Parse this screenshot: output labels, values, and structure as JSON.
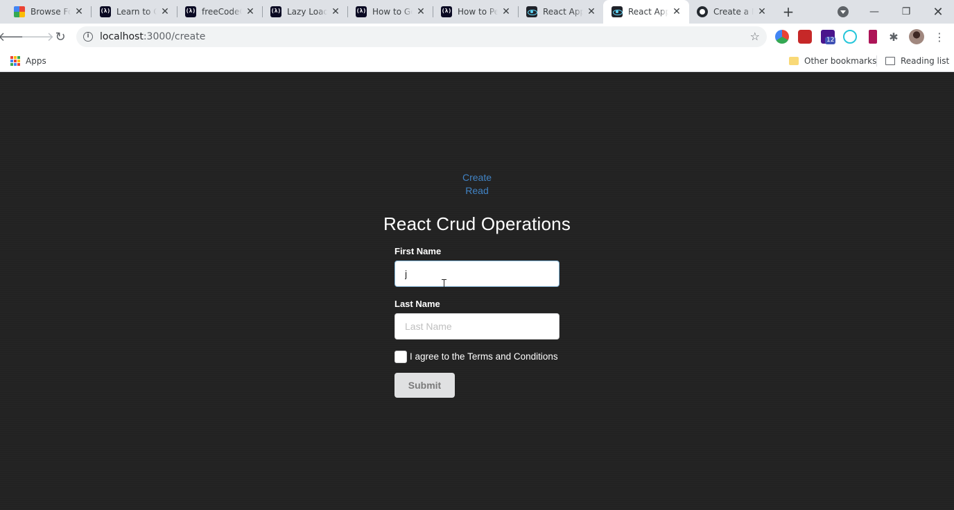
{
  "browser": {
    "tabs": [
      {
        "title": "Browse Fonts - Google Fonts",
        "icon": "google-fonts-icon"
      },
      {
        "title": "Learn to Code — For Free",
        "icon": "freecodecamp-icon"
      },
      {
        "title": "freeCodeCamp",
        "icon": "freecodecamp-icon"
      },
      {
        "title": "Lazy Loading",
        "icon": "freecodecamp-icon"
      },
      {
        "title": "How to Get",
        "icon": "freecodecamp-icon"
      },
      {
        "title": "How to Perform",
        "icon": "freecodecamp-icon"
      },
      {
        "title": "React App",
        "icon": "react-icon"
      },
      {
        "title": "React App",
        "icon": "react-icon",
        "active": true
      },
      {
        "title": "Create a New Repository",
        "icon": "github-icon"
      }
    ],
    "new_tab": "+",
    "url_host": "localhost",
    "url_path": ":3000/create",
    "extension_badge": "12"
  },
  "bookmarks": {
    "apps": "Apps",
    "other": "Other bookmarks",
    "reading_list": "Reading list"
  },
  "page": {
    "nav_create": "Create",
    "nav_read": "Read",
    "title": "React Crud Operations",
    "first_name_label": "First Name",
    "first_name_value": "j",
    "last_name_label": "Last Name",
    "last_name_placeholder": "Last Name",
    "last_name_value": "",
    "terms_label": "I agree to the Terms and Conditions",
    "terms_checked": false,
    "submit_label": "Submit"
  },
  "colors": {
    "page_bg": "#222222",
    "link": "#4183c4",
    "heading": "#ffffff",
    "button_bg": "#e0e1e2",
    "tabstrip": "#dee1e6"
  }
}
